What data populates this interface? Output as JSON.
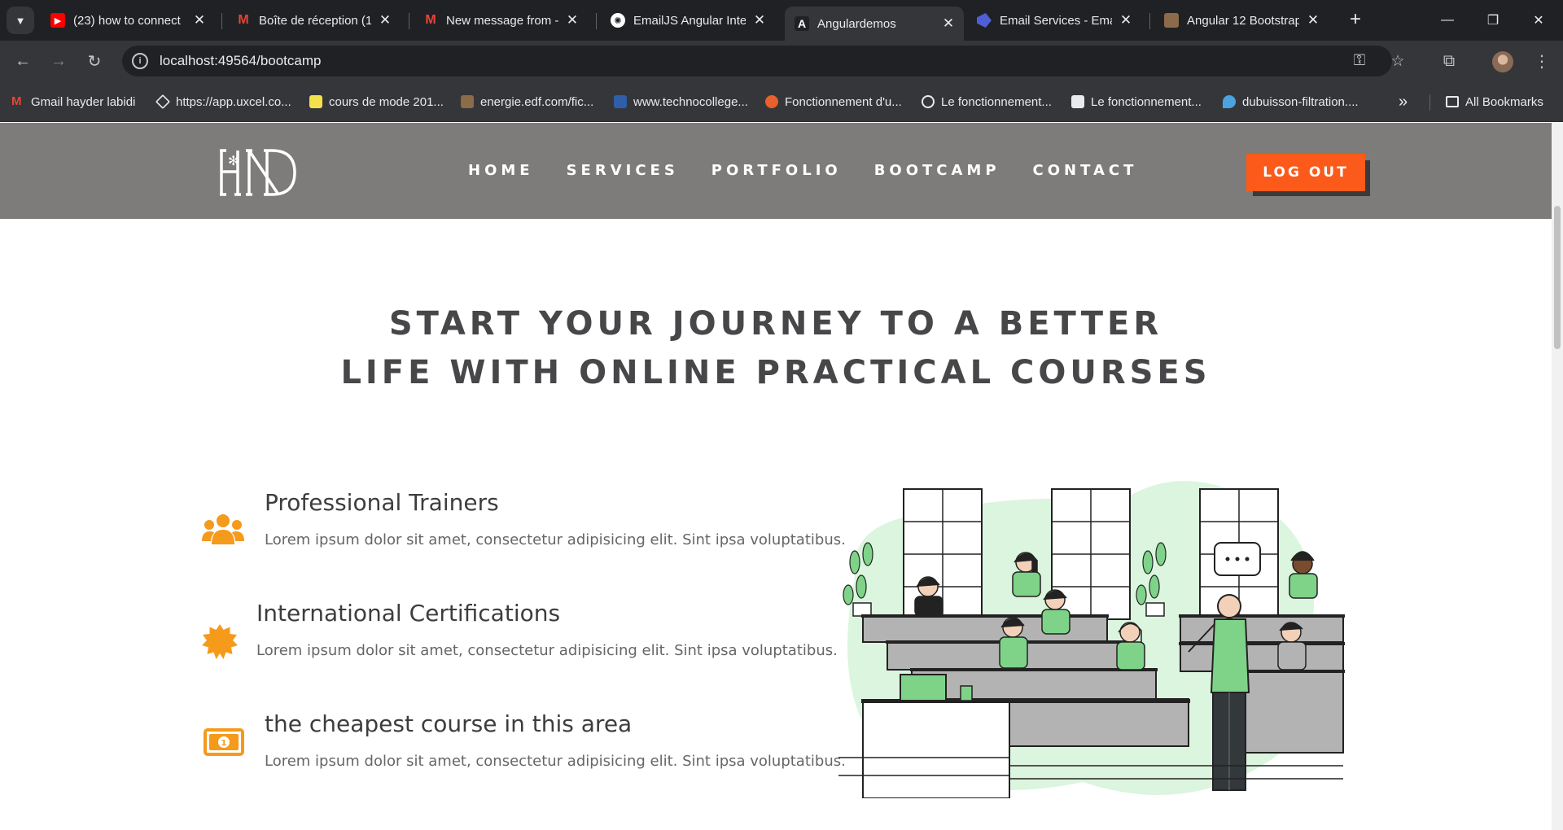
{
  "browser": {
    "tabs": [
      {
        "title": "(23) how to connect",
        "favicon": "youtube-icon",
        "color": "#ff0000"
      },
      {
        "title": "Boîte de réception (1",
        "favicon": "gmail-icon",
        "color": "#ea4335"
      },
      {
        "title": "New message from -",
        "favicon": "gmail-icon",
        "color": "#ea4335"
      },
      {
        "title": "EmailJS Angular Integ",
        "favicon": "chatgpt-icon",
        "color": "#ffffff"
      },
      {
        "title": "Angulardemos",
        "favicon": "angular-icon",
        "color": "#ffffff",
        "active": true
      },
      {
        "title": "Email Services - Emai",
        "favicon": "emailjs-icon",
        "color": "#4f5fd8"
      },
      {
        "title": "Angular 12 Bootstrap",
        "favicon": "image-icon",
        "color": "#8b6b4a"
      }
    ],
    "url": "localhost:49564/bootcamp",
    "bookmarks": [
      {
        "label": "Gmail hayder labidi",
        "color": "#ea4335"
      },
      {
        "label": "https://app.uxcel.co...",
        "color": "#e8eaed"
      },
      {
        "label": "cours de mode 201...",
        "color": "#f4e04d"
      },
      {
        "label": "energie.edf.com/fic...",
        "color": "#8b6b4a"
      },
      {
        "label": "www.technocollege...",
        "color": "#2f5fa8"
      },
      {
        "label": "Fonctionnement d'u...",
        "color": "#e8602c"
      },
      {
        "label": "Le fonctionnement...",
        "color": "#e8eaed"
      },
      {
        "label": "Le fonctionnement...",
        "color": "#e8eaed"
      },
      {
        "label": "dubuisson-filtration....",
        "color": "#4aa3df"
      }
    ],
    "all_bookmarks": "All Bookmarks"
  },
  "site": {
    "nav": [
      "HOME",
      "SERVICES",
      "PORTFOLIO",
      "BOOTCAMP",
      "CONTACT"
    ],
    "logout": "LOG OUT",
    "accent": "#fc5a1a",
    "header_bg": "#7e7b7b"
  },
  "hero": {
    "line1": "START YOUR JOURNEY TO A BETTER",
    "line2": "LIFE WITH ONLINE PRACTICAL COURSES"
  },
  "features": [
    {
      "title": "Professional Trainers",
      "text": "Lorem ipsum dolor sit amet, consectetur adipisicing elit. Sint ipsa voluptatibus.",
      "icon": "users-icon"
    },
    {
      "title": "International Certifications",
      "text": "Lorem ipsum dolor sit amet, consectetur adipisicing elit. Sint ipsa voluptatibus.",
      "icon": "certificate-icon"
    },
    {
      "title": "the cheapest course in this area",
      "text": "Lorem ipsum dolor sit amet, consectetur adipisicing elit. Sint ipsa voluptatibus.",
      "icon": "money-bill-icon"
    }
  ],
  "icon_color": "#f59a1b"
}
